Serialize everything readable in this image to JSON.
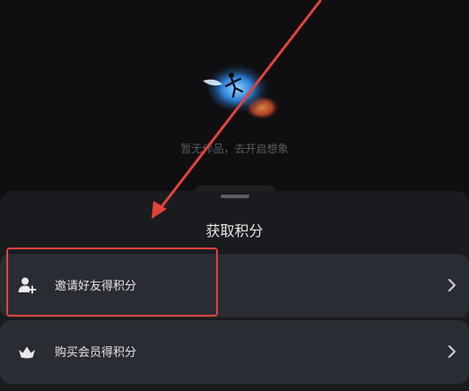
{
  "background": {
    "empty_text": "暂无作品，去开启想象"
  },
  "sheet": {
    "title": "获取积分",
    "items": [
      {
        "label": "邀请好友得积分",
        "icon": "add-person-icon"
      },
      {
        "label": "购买会员得积分",
        "icon": "crown-icon"
      }
    ]
  },
  "annotation": {
    "color": "#e0443c"
  }
}
